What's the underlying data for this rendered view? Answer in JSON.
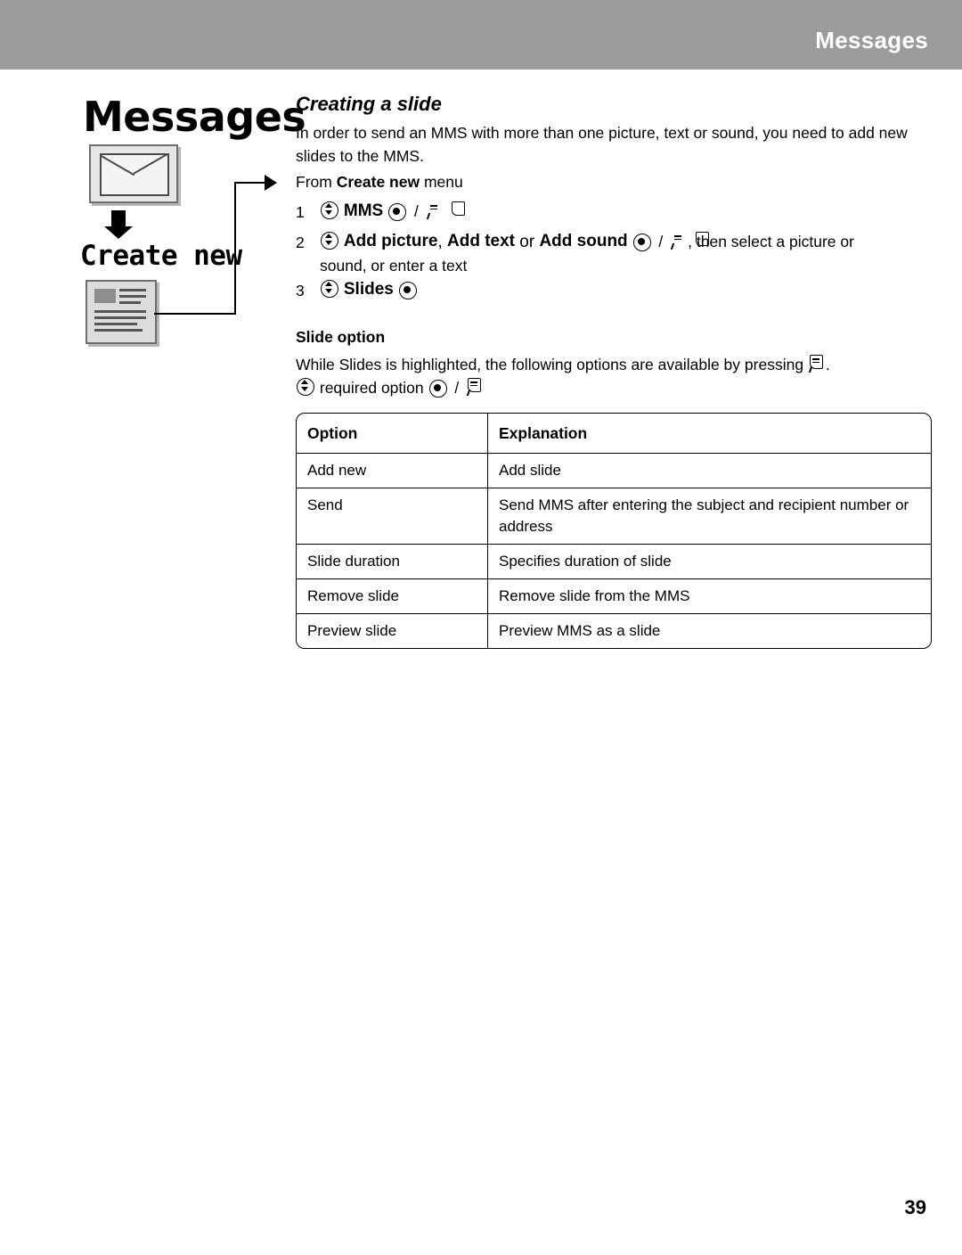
{
  "header": {
    "title": "Messages"
  },
  "sidebar": {
    "chapter_title": "Messages",
    "menu_label": "Create new",
    "icons": {
      "envelope": "envelope-icon",
      "arrow": "down-arrow-icon",
      "document": "document-icon"
    }
  },
  "content": {
    "section_title": "Creating a slide",
    "intro": "In order to send an MMS with more than one picture, text or sound, you need to add new slides to the MMS.",
    "from_prefix": "From ",
    "from_bold": "Create new",
    "from_suffix": " menu",
    "steps": [
      {
        "num": "1",
        "bold": "MMS",
        "tail": ""
      },
      {
        "num": "2",
        "bold": "Add picture, Add text or Add sound",
        "tail": ", then select a picture or sound, or enter a text"
      },
      {
        "num": "3",
        "bold": "Slides",
        "tail": ""
      }
    ],
    "step2_parts": {
      "b1": "Add picture",
      "c1": ", ",
      "b2": "Add text",
      "c2": " or ",
      "b3": "Add sound",
      "after": ", then select a picture or",
      "line2": "sound, or enter a text"
    },
    "slide_option_heading": "Slide option",
    "while_text_before": "While Slides is highlighted, the following options are available by pressing ",
    "while_text_after": ".",
    "required_option": "required option",
    "separator": "/"
  },
  "table": {
    "headers": [
      "Option",
      "Explanation"
    ],
    "rows": [
      [
        "Add new",
        "Add slide"
      ],
      [
        "Send",
        "Send MMS after entering the subject and recipient number or address"
      ],
      [
        "Slide duration",
        "Specifies duration of slide"
      ],
      [
        "Remove slide",
        "Remove slide from the MMS"
      ],
      [
        "Preview slide",
        "Preview MMS as a slide"
      ]
    ]
  },
  "footer": {
    "page_number": "39"
  },
  "colors": {
    "header_band": "#9b9b9b",
    "header_text": "#ffffff",
    "body_text": "#000000"
  }
}
